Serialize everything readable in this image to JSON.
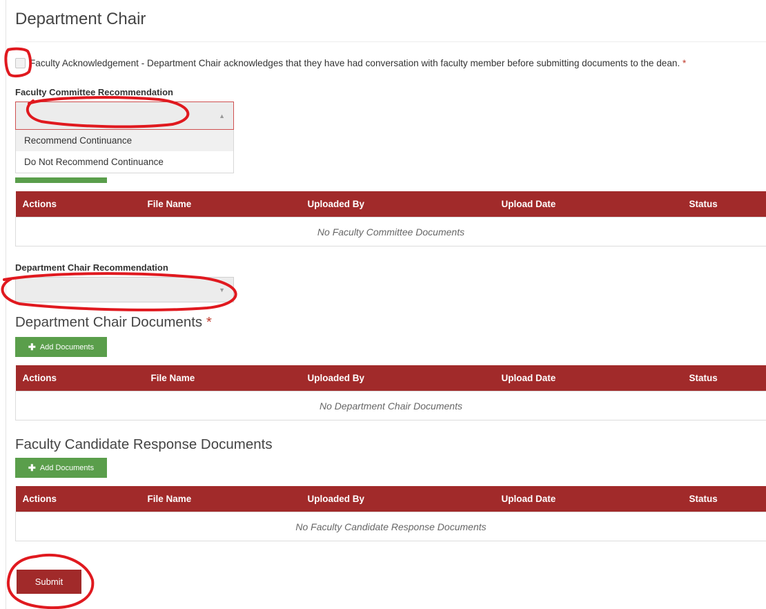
{
  "page": {
    "title": "Department Chair"
  },
  "acknowledgement": {
    "label": "Faculty Acknowledgement - Department Chair acknowledges that they have had conversation with faculty member before submitting documents to the dean.",
    "required_marker": "*"
  },
  "faculty_committee": {
    "label": "Faculty Committee Recommendation",
    "selected": "",
    "caret": "▲",
    "options": [
      "Recommend Continuance",
      "Do Not Recommend Continuance"
    ],
    "table": {
      "headers": [
        "Actions",
        "File Name",
        "Uploaded By",
        "Upload Date",
        "Status"
      ],
      "empty_message": "No Faculty Committee Documents"
    }
  },
  "department_chair_recommendation": {
    "label": "Department Chair Recommendation",
    "selected": "",
    "caret": "▼"
  },
  "department_chair_documents": {
    "title": "Department Chair Documents",
    "required_marker": "*",
    "add_button": "Add Documents",
    "table": {
      "headers": [
        "Actions",
        "File Name",
        "Uploaded By",
        "Upload Date",
        "Status"
      ],
      "empty_message": "No Department Chair Documents"
    }
  },
  "faculty_candidate_response": {
    "title": "Faculty Candidate Response Documents",
    "add_button": "Add Documents",
    "table": {
      "headers": [
        "Actions",
        "File Name",
        "Uploaded By",
        "Upload Date",
        "Status"
      ],
      "empty_message": "No Faculty Candidate Response Documents"
    }
  },
  "submit": {
    "label": "Submit"
  },
  "colors": {
    "table_header": "#a12a2a",
    "add_button": "#5a9e4b",
    "submit_button": "#a12a2a",
    "annotation_marks": "#e0191f"
  },
  "icons": {
    "add": "plus-icon",
    "dropdown": "caret-icon"
  }
}
